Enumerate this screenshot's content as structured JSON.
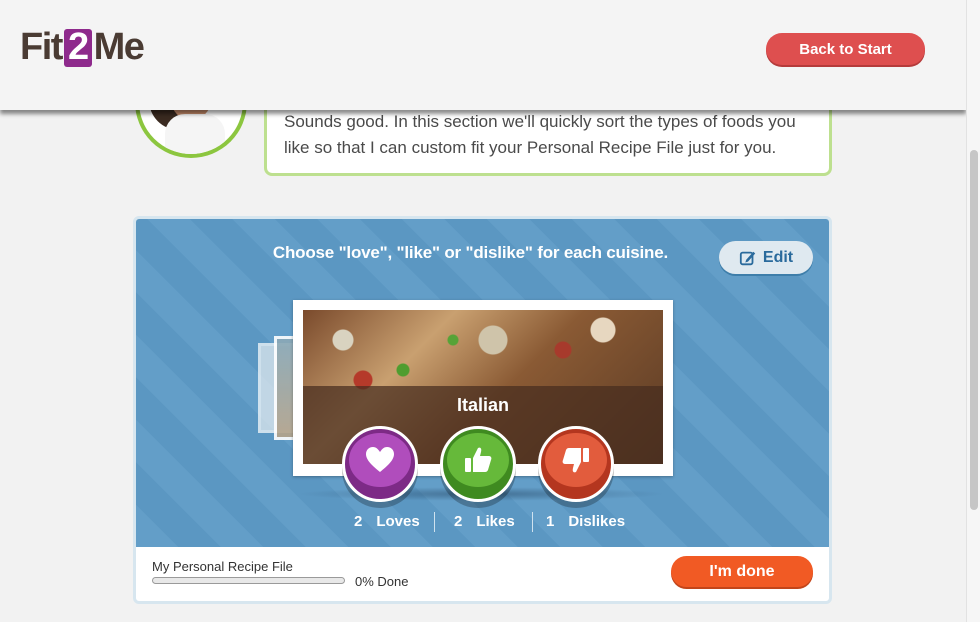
{
  "header": {
    "logo": {
      "part1": "Fit",
      "part2": "2",
      "part3": "Me"
    },
    "back_button": "Back to Start"
  },
  "speech": {
    "text": "Sounds good. In this section we'll quickly sort the types of foods you like so that I can custom fit your Personal Recipe File just for you."
  },
  "panel": {
    "instruction": "Choose \"love\", \"like\" or \"dislike\" for each cuisine.",
    "edit_label": "Edit",
    "card": {
      "cuisine": "Italian"
    },
    "ratings": {
      "love": {
        "count": "2",
        "label": "Loves",
        "icon": "heart-icon"
      },
      "like": {
        "count": "2",
        "label": "Likes",
        "icon": "thumbs-up-icon"
      },
      "dislike": {
        "count": "1",
        "label": "Dislikes",
        "icon": "thumbs-down-icon"
      }
    },
    "footer": {
      "file_label": "My Personal Recipe File",
      "progress_text": "0% Done",
      "progress_value": 0,
      "done_button": "I'm done"
    }
  },
  "colors": {
    "brand_purple": "#8e2a8c",
    "back_button": "#de4f4f",
    "panel_blue": "#5d9ac6",
    "love": "#7d2a86",
    "like": "#3f8a20",
    "dislike": "#b4361f",
    "done_button": "#f15a24",
    "speech_border": "#bde08f"
  }
}
